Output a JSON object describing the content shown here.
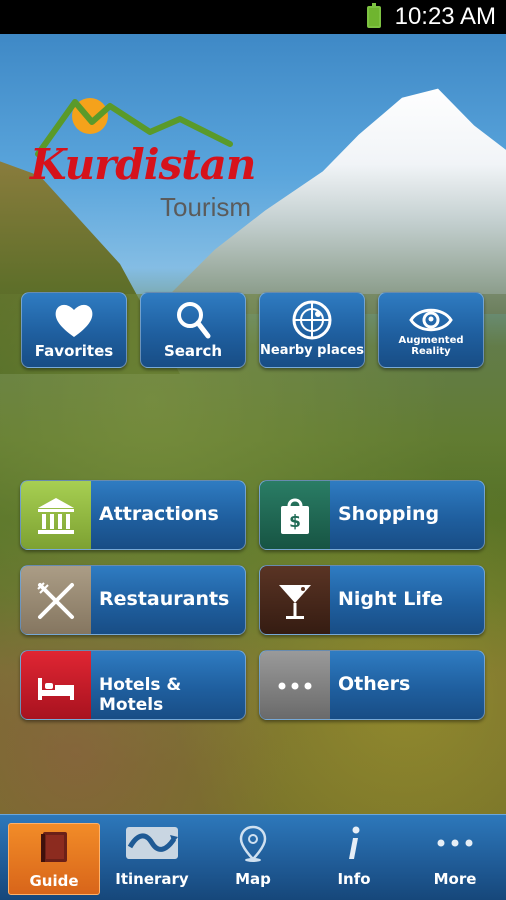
{
  "status_bar": {
    "time": "10:23 AM"
  },
  "logo": {
    "title": "Kurdistan",
    "subtitle": "Tourism"
  },
  "quick_actions": [
    {
      "label": "Favorites",
      "icon": "heart-icon"
    },
    {
      "label": "Search",
      "icon": "magnifier-icon"
    },
    {
      "label": "Nearby places",
      "icon": "radar-icon"
    },
    {
      "label": "Augmented Reality",
      "icon": "eye-icon"
    }
  ],
  "categories": [
    {
      "label": "Attractions",
      "icon": "museum-icon",
      "color": "#8cb63c"
    },
    {
      "label": "Shopping",
      "icon": "shopping-bag-icon",
      "color": "#1f6b55"
    },
    {
      "label": "Restaurants",
      "icon": "fork-knife-icon",
      "color": "#9b8c76"
    },
    {
      "label": "Night Life",
      "icon": "cocktail-icon",
      "color": "#4a2a1e"
    },
    {
      "label": "Hotels & Motels",
      "icon": "bed-icon",
      "color": "#c91c2a"
    },
    {
      "label": "Others",
      "icon": "more-dots-icon",
      "color": "#7f7f7f"
    }
  ],
  "tabs": [
    {
      "label": "Guide",
      "icon": "book-icon",
      "active": true
    },
    {
      "label": "Itinerary",
      "icon": "route-icon",
      "active": false
    },
    {
      "label": "Map",
      "icon": "map-pin-icon",
      "active": false
    },
    {
      "label": "Info",
      "icon": "info-icon",
      "active": false
    },
    {
      "label": "More",
      "icon": "more-dots-icon",
      "active": false
    }
  ]
}
